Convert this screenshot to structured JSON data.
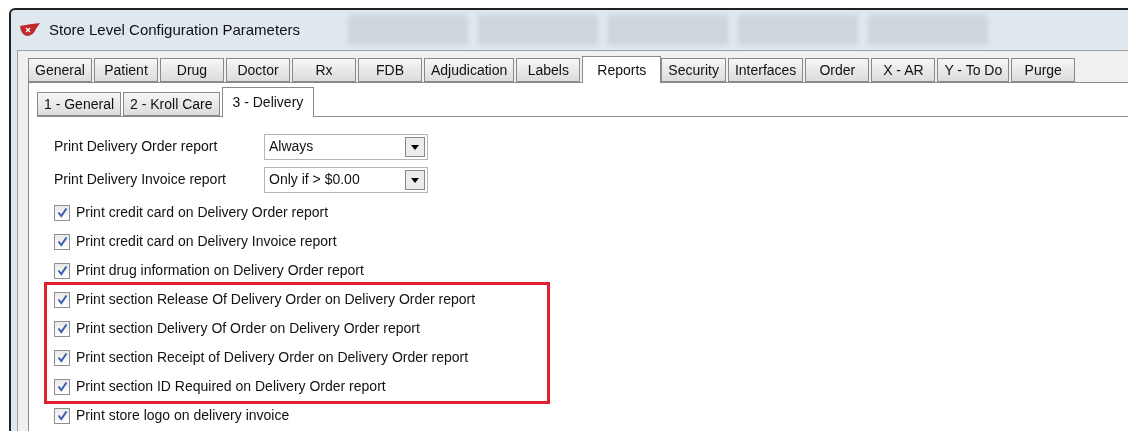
{
  "window": {
    "title": "Store Level Configuration Parameters"
  },
  "tabs": [
    {
      "label": "General",
      "selected": false
    },
    {
      "label": "Patient",
      "selected": false
    },
    {
      "label": "Drug",
      "selected": false
    },
    {
      "label": "Doctor",
      "selected": false
    },
    {
      "label": "Rx",
      "selected": false
    },
    {
      "label": "FDB",
      "selected": false
    },
    {
      "label": "Adjudication",
      "selected": false
    },
    {
      "label": "Labels",
      "selected": false
    },
    {
      "label": "Reports",
      "selected": true
    },
    {
      "label": "Security",
      "selected": false
    },
    {
      "label": "Interfaces",
      "selected": false
    },
    {
      "label": "Order",
      "selected": false
    },
    {
      "label": "X - AR",
      "selected": false
    },
    {
      "label": "Y - To Do",
      "selected": false
    },
    {
      "label": "Purge",
      "selected": false
    }
  ],
  "subtabs": [
    {
      "label": "1 - General",
      "selected": false
    },
    {
      "label": "2 - Kroll Care",
      "selected": false
    },
    {
      "label": "3 - Delivery",
      "selected": true
    }
  ],
  "dropdowns": [
    {
      "label": "Print Delivery Order report",
      "value": "Always"
    },
    {
      "label": "Print Delivery Invoice report",
      "value": "Only if > $0.00"
    }
  ],
  "highlight": {
    "color": "#e0202c"
  },
  "options": [
    {
      "label": "Print credit card on Delivery Order report",
      "checked": true,
      "highlighted": false
    },
    {
      "label": "Print credit card on Delivery Invoice report",
      "checked": true,
      "highlighted": false
    },
    {
      "label": "Print drug information on Delivery Order report",
      "checked": true,
      "highlighted": false
    },
    {
      "label": "Print section Release Of Delivery Order on Delivery Order report",
      "checked": true,
      "highlighted": true
    },
    {
      "label": "Print section Delivery Of Order on Delivery Order report",
      "checked": true,
      "highlighted": true
    },
    {
      "label": "Print section Receipt of Delivery Order on Delivery Order report",
      "checked": true,
      "highlighted": true
    },
    {
      "label": "Print section ID Required on Delivery Order report",
      "checked": true,
      "highlighted": true
    },
    {
      "label": "Print store logo on delivery invoice",
      "checked": true,
      "highlighted": false
    }
  ]
}
